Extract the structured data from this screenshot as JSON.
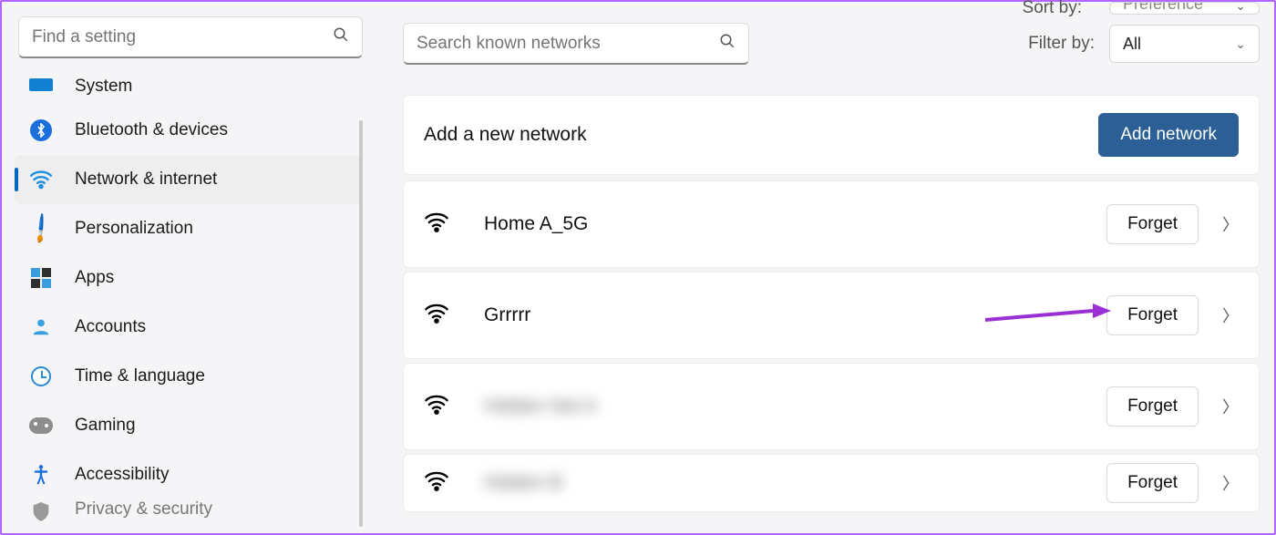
{
  "sidebar": {
    "search_placeholder": "Find a setting",
    "items": [
      {
        "label": "System"
      },
      {
        "label": "Bluetooth & devices",
        "bt_glyph": "⋉"
      },
      {
        "label": "Network & internet"
      },
      {
        "label": "Personalization"
      },
      {
        "label": "Apps"
      },
      {
        "label": "Accounts"
      },
      {
        "label": "Time & language"
      },
      {
        "label": "Gaming"
      },
      {
        "label": "Accessibility"
      },
      {
        "label": "Privacy & security"
      }
    ]
  },
  "toolbar": {
    "sort_label": "Sort by:",
    "sort_value": "Preference",
    "filter_label": "Filter by:",
    "filter_value": "All",
    "known_search_placeholder": "Search known networks"
  },
  "add_card": {
    "title": "Add a new network",
    "button": "Add network"
  },
  "networks": [
    {
      "name": "Home A_5G",
      "forget": "Forget",
      "blurred": false
    },
    {
      "name": "Grrrrr",
      "forget": "Forget",
      "blurred": false
    },
    {
      "name": "Hidden Net A",
      "forget": "Forget",
      "blurred": true
    },
    {
      "name": "Hidden B",
      "forget": "Forget",
      "blurred": true
    }
  ],
  "colors": {
    "accent": "#2b5f96",
    "highlight_arrow": "#9b2fd6"
  }
}
